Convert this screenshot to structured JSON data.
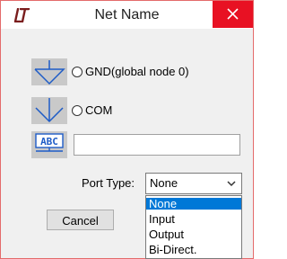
{
  "window": {
    "title": "Net Name",
    "app_icon": "ltspice-logo-icon",
    "close_icon": "close-icon"
  },
  "options": {
    "gnd_label": "GND(global node 0)",
    "com_label": "COM",
    "gnd_icon": "ground-symbol-icon",
    "com_icon": "com-symbol-icon",
    "label_icon": "abc-label-icon",
    "label_icon_text": "ABC"
  },
  "net_name_input": {
    "value": ""
  },
  "port_type": {
    "label": "Port Type:",
    "selected": "None",
    "options": [
      "None",
      "Input",
      "Output",
      "Bi-Direct."
    ]
  },
  "buttons": {
    "cancel": "Cancel"
  },
  "colors": {
    "close_bg": "#e81123",
    "symbol_blue": "#1e5cc7",
    "selection": "#0078d7",
    "icon_bg": "#c9c9c9"
  }
}
